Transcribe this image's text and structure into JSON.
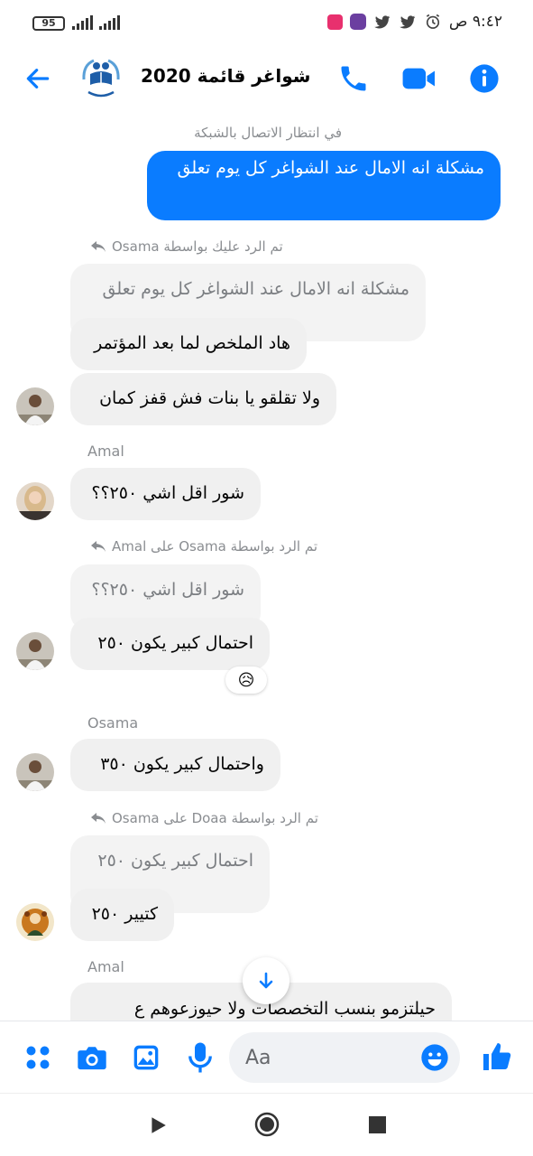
{
  "status_bar": {
    "time": "٩:٤٢ ص",
    "battery": "95"
  },
  "header": {
    "title": "شواغر قائمة 2020",
    "status": "في انتظار الاتصال بالشبكة"
  },
  "messages": {
    "mine_text": "مشكلة انه الامال عند الشواغر كل يوم تعلق",
    "reply1_label": "Osama تم الرد عليك بواسطة",
    "reply1_quote": "مشكلة انه الامال عند الشواغر كل يوم تعلق",
    "osama_msg1": "هاد الملخص لما بعد المؤتمر",
    "osama_msg2": "ولا تقلقو يا بنات فش قفز كمان",
    "amal_name": "Amal",
    "amal_msg1": "شور اقل  اشي ٢٥٠؟؟",
    "reply2_label": "Amal على Osama تم الرد بواسطة",
    "reply2_quote": "شور اقل  اشي ٢٥٠؟؟",
    "osama_msg3": "احتمال كبير يكون ٢٥٠",
    "reaction": "😥",
    "osama_name": "Osama",
    "osama_msg4": "واحتمال كبير يكون ٣٥٠",
    "reply3_label": "Osama على Doaa تم الرد بواسطة",
    "reply3_quote": "احتمال كبير يكون ٢٥٠",
    "doaa_msg1": "كتيير ٢٥٠",
    "amal_name2": "Amal",
    "amal_msg2": "حيلتزمو بنسب التخصصات ولا حيوزعوهم ع"
  },
  "composer": {
    "placeholder": "Aa"
  },
  "icons": {
    "back": "back-arrow-icon",
    "call": "phone-icon",
    "video": "video-icon",
    "info": "info-icon",
    "menu": "grid-menu-icon",
    "camera": "camera-icon",
    "gallery": "image-icon",
    "mic": "microphone-icon",
    "emoji": "emoji-icon",
    "like": "thumbs-up-icon",
    "reply": "reply-arrow-icon",
    "scroll": "arrow-down-icon"
  },
  "colors": {
    "accent": "#0a7cff",
    "bubble_in": "#f0f0f0",
    "meta_text": "#8a8d91"
  }
}
